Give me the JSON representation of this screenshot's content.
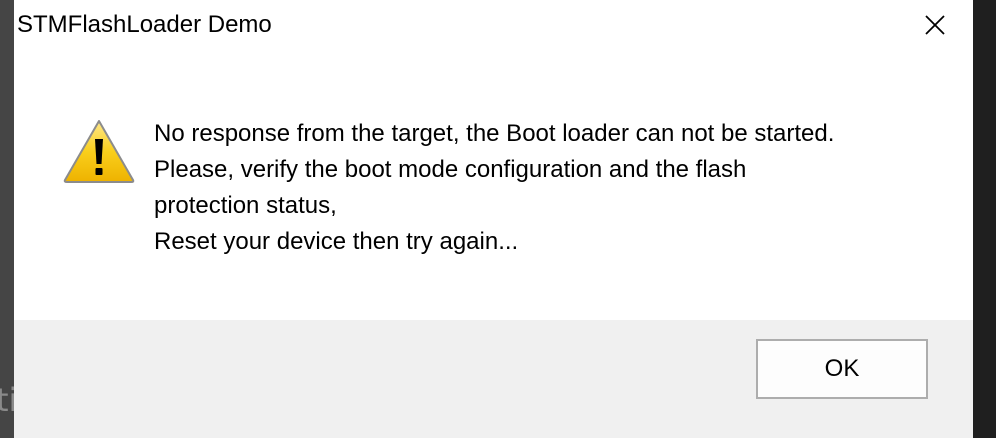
{
  "window": {
    "title": "STMFlashLoader Demo"
  },
  "dialog": {
    "icon": "warning-icon",
    "message_lines": [
      "No response from the target, the Boot loader can not be started.",
      "Please, verify the boot mode configuration and the flash",
      "protection status,",
      "Reset your device then try again..."
    ],
    "ok_label": "OK"
  },
  "background": {
    "left_text": "ti"
  },
  "colors": {
    "dialog_bg": "#ffffff",
    "footer_bg": "#f0f0f0",
    "button_border": "#adadad",
    "warning_fill": "#f5c200",
    "text": "#000000"
  }
}
